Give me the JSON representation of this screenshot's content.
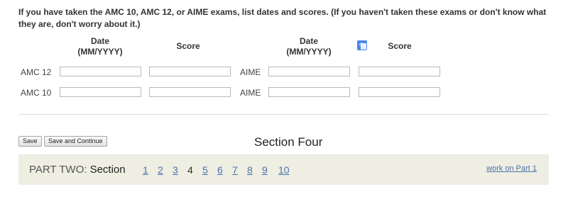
{
  "intro_text": "If you have taken the AMC 10, AMC 12, or AIME exams, list dates and scores. (If you haven't taken these exams or don't know what they are, don't worry about it.)",
  "headers": {
    "date_line1": "Date",
    "date_line2": "(MM/YYYY)",
    "score": "Score"
  },
  "rows": [
    {
      "left_label": "AMC 12",
      "right_label": "AIME",
      "left_date": "",
      "left_score": "",
      "right_date": "",
      "right_score": ""
    },
    {
      "left_label": "AMC 10",
      "right_label": "AIME",
      "left_date": "",
      "left_score": "",
      "right_date": "",
      "right_score": ""
    }
  ],
  "icons": {
    "translate": "google-translate-icon"
  },
  "buttons": {
    "save": "Save",
    "save_continue": "Save and Continue"
  },
  "section_title": "Section Four",
  "nav": {
    "part_prefix": "PART TWO: ",
    "section_word": "Section",
    "pages": [
      "1",
      "2",
      "3",
      "4",
      "5",
      "6",
      "7",
      "8",
      "9",
      "10"
    ],
    "current_page": "4",
    "work_link": "work on Part 1"
  },
  "colors": {
    "link": "#4b72a8",
    "nav_bg": "#eeeee3",
    "translate": "#4a86e8"
  }
}
